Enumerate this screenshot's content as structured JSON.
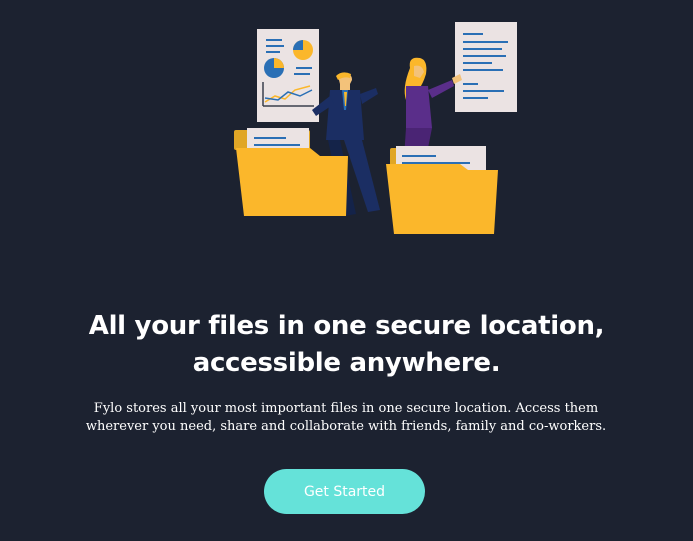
{
  "hero": {
    "illustration_icon": "intro-illustration",
    "headline_line1": "All your files in one secure location,",
    "headline_line2": "accessible anywhere.",
    "description": "Fylo stores all your most important files in one secure location. Access them wherever you need, share and collaborate with friends, family and co-workers.",
    "cta_label": "Get Started"
  },
  "colors": {
    "background": "#1c2230",
    "accent": "#65e2d9",
    "folder": "#fbb72b",
    "document": "#ebe3e3",
    "document_lines": "#2a6fb5"
  }
}
